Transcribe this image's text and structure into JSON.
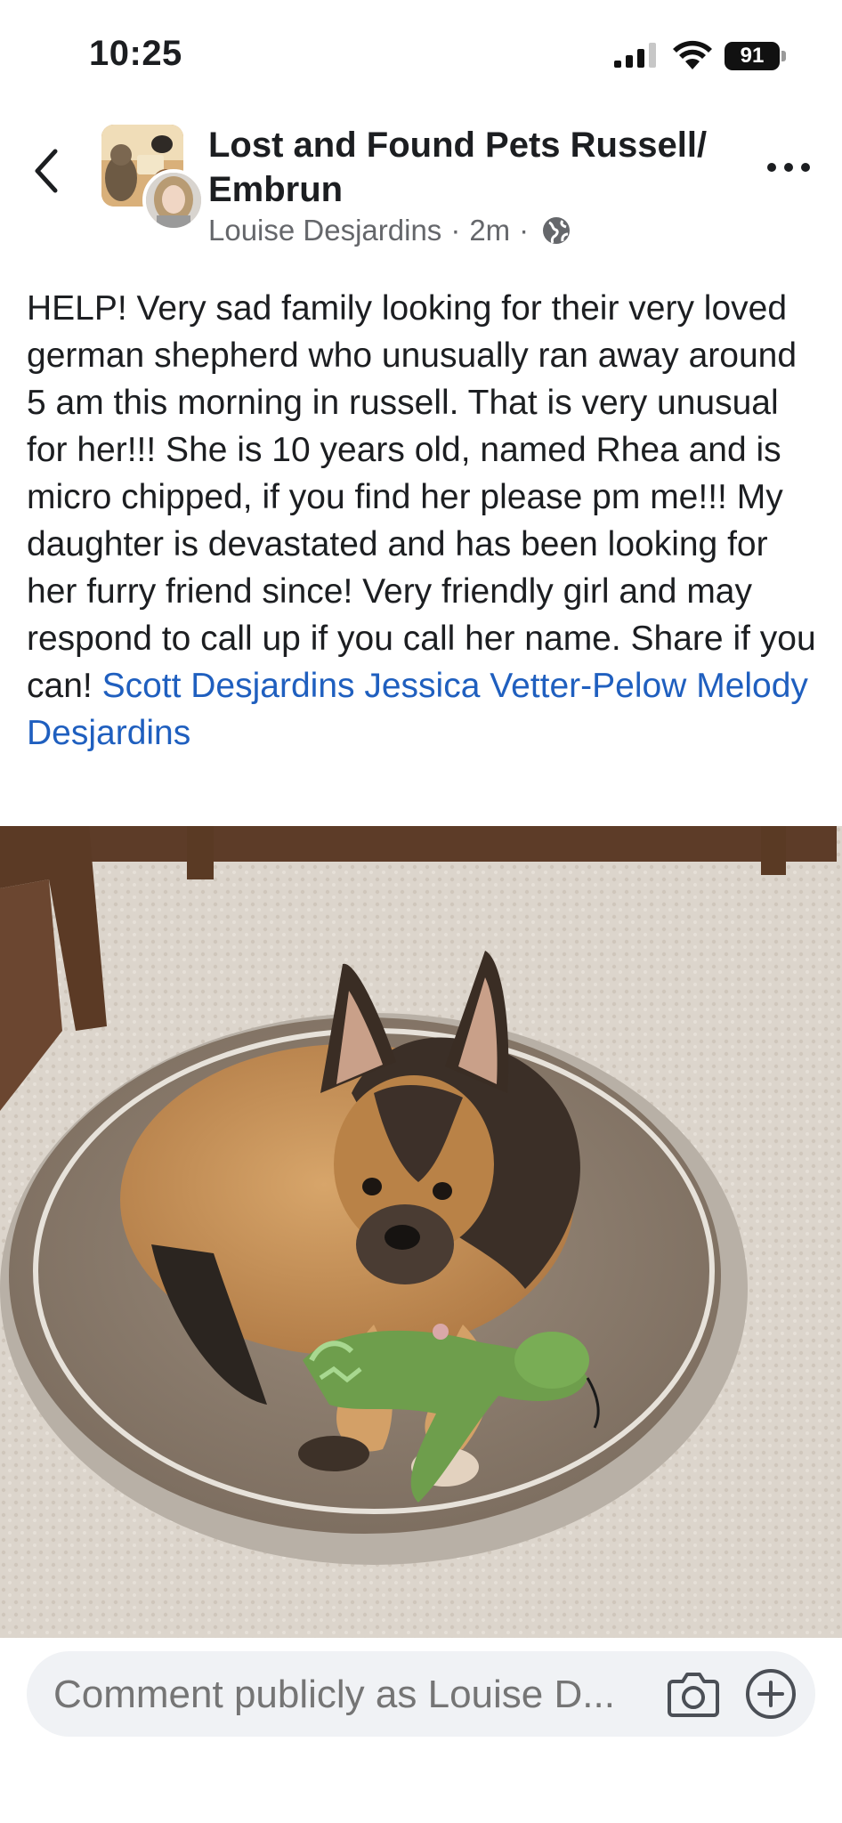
{
  "status_bar": {
    "time": "10:25",
    "battery": "91",
    "icons": [
      "cellular-signal-icon",
      "wifi-icon",
      "battery-icon"
    ]
  },
  "header": {
    "back_icon": "chevron-left-icon",
    "page_title": "Lost and Found Pets Russell/ Embrun",
    "author": "Louise Desjardins",
    "separator": "·",
    "time_ago": "2m",
    "audience_icon": "globe-icon",
    "more_icon": "ellipsis-icon"
  },
  "post": {
    "body": "HELP! Very sad family looking for their very loved german shepherd who unusually ran away around 5 am this morning in russell. That is very unusual for her!!! She is 10 years old, named Rhea and is micro chipped, if you find her please pm me!!! My daughter is devastated and has been looking for her furry friend since! Very friendly girl and may respond to call up if you call her name. Share if you can!",
    "tags": [
      "Scott Desjardins",
      "Jessica Vetter-Pelow",
      "Melody Desjardins"
    ],
    "photo": "german-shepherd-on-dog-bed-photo"
  },
  "comment": {
    "placeholder": "Comment publicly as Louise D...",
    "camera_icon": "camera-icon",
    "add_icon": "plus-circle-icon"
  },
  "colors": {
    "link": "#1f5fbf",
    "meta": "#65676b",
    "comment_bg": "#f0f2f5",
    "text": "#1c1e21"
  }
}
